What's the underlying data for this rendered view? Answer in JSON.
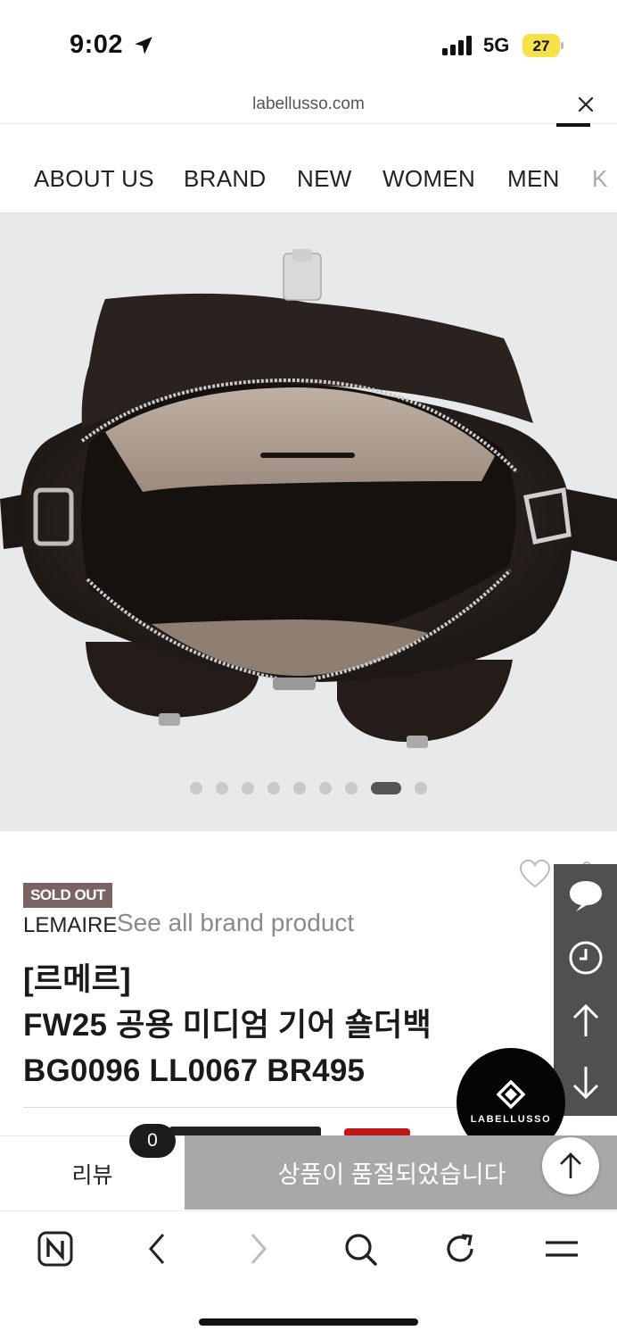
{
  "status_bar": {
    "time": "9:02",
    "network": "5G",
    "battery": "27"
  },
  "browser": {
    "url": "labellusso.com"
  },
  "nav": {
    "items": [
      "ABOUT US",
      "BRAND",
      "NEW",
      "WOMEN",
      "MEN",
      "K"
    ]
  },
  "carousel": {
    "total": 9,
    "active_index": 7
  },
  "product": {
    "badge": "SOLD OUT",
    "brand": "LEMAIRE",
    "see_all": "See all brand product",
    "title_lines": [
      "[르메르]",
      "FW25 공용 미디엄 기어 숄더백",
      "BG0096 LL0067 BR495"
    ]
  },
  "side_bar": {
    "icons": [
      "chat-icon",
      "clock-icon",
      "arrow-up-icon",
      "arrow-down-icon"
    ]
  },
  "logo": {
    "text": "LABELLUSSO"
  },
  "actions": {
    "review_label": "리뷰",
    "review_count": "0",
    "sold_out_label": "상품이 품절되었습니다"
  },
  "colors": {
    "sold_badge": "#7a6463",
    "sold_button": "#a8a8a8",
    "side_bar": "#505050",
    "image_bg": "#e8e9ea"
  }
}
